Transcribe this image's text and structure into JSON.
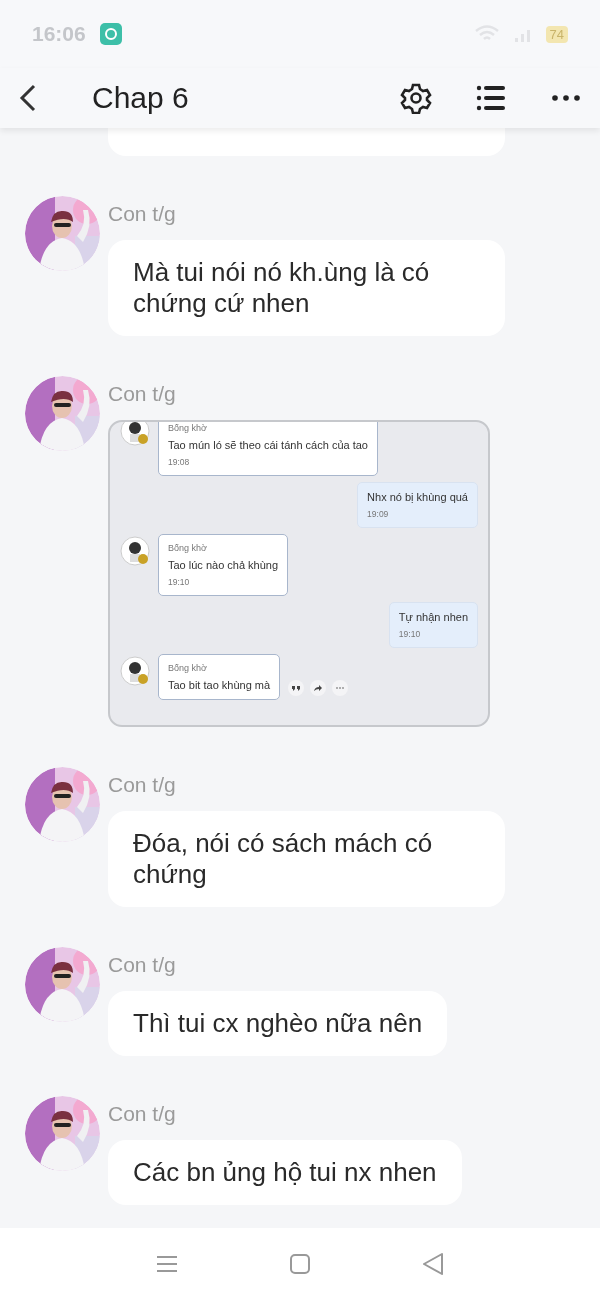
{
  "status_bar": {
    "time": "16:06",
    "battery": "74"
  },
  "header": {
    "title": "Chap 6"
  },
  "messages": [
    {
      "kind": "cut"
    },
    {
      "kind": "text",
      "sender": "Con t/g",
      "text": "Mà tui nói nó kh.ùng là có chứng cứ nhen"
    },
    {
      "sender": "Con t/g",
      "screenshot": {
        "messages": [
          {
            "kind": "incoming",
            "sender": "Bống khờ",
            "text": "Tao mún ló sẽ theo cái tánh cách của tao",
            "time": "19:08"
          },
          {
            "kind": "outgoing",
            "text": "Nhx nó bị khùng quá",
            "time": "19:09"
          },
          {
            "kind": "incoming",
            "sender": "Bống khờ",
            "text": "Tao lúc nào chả khùng",
            "time": "19:10"
          },
          {
            "kind": "outgoing",
            "text": "Tự nhận nhen",
            "time": "19:10"
          },
          {
            "kind": "incoming",
            "sender": "Bống khờ",
            "text": "Tao bit tao khùng mà",
            "actions": true
          }
        ]
      }
    },
    {
      "kind": "text",
      "sender": "Con t/g",
      "text": "Đóa, nói có sách mách có chứng"
    },
    {
      "kind": "text",
      "sender": "Con t/g",
      "text": "Thì tui cx nghèo nữa nên"
    },
    {
      "kind": "text",
      "sender": "Con t/g",
      "text": "Các bn ủng hộ tui nx nhen"
    }
  ]
}
